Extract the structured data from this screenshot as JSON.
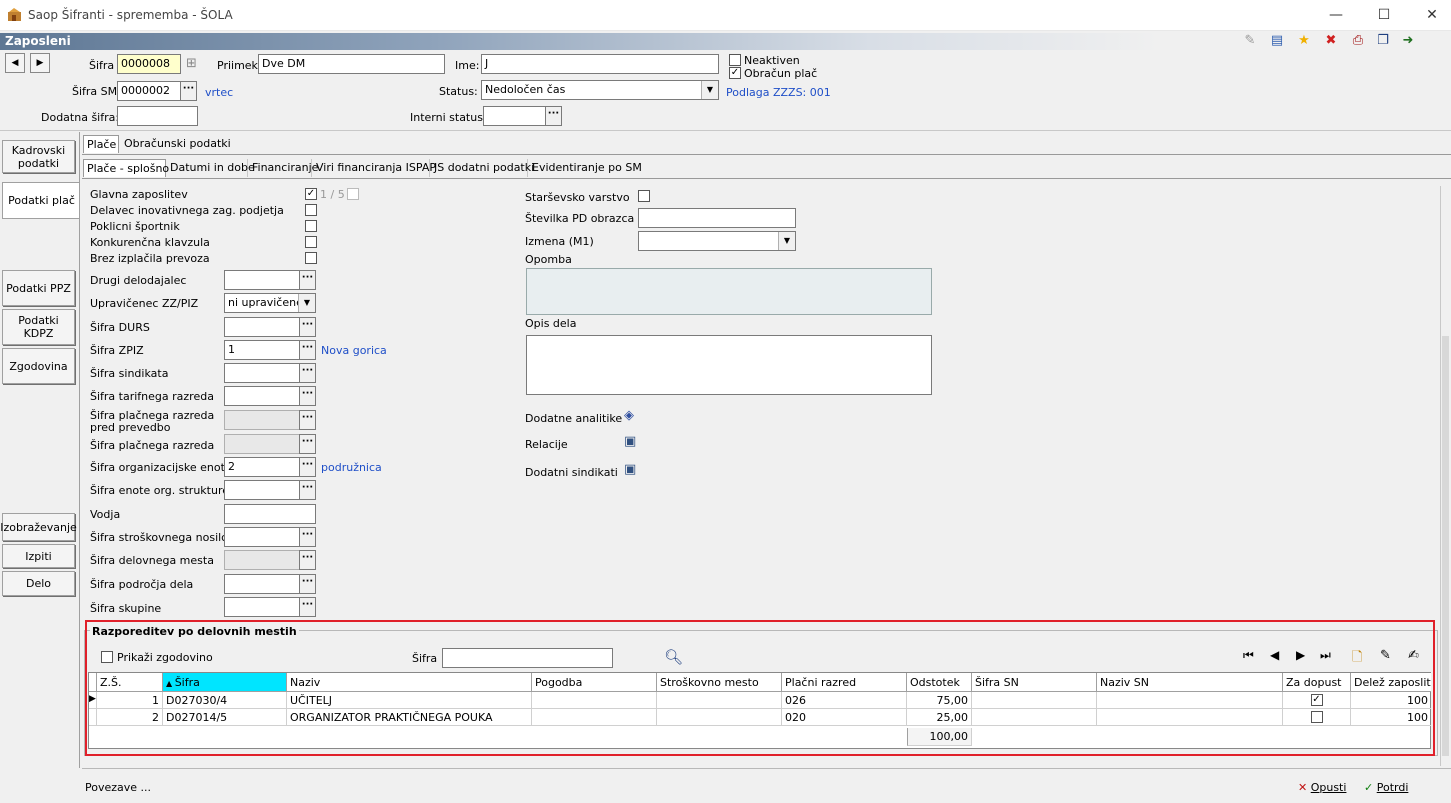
{
  "window": {
    "title": "Saop Šifranti - sprememba - ŠOLA",
    "header": "Zaposleni"
  },
  "top": {
    "sifra_label": "Šifra",
    "sifra_value": "0000008",
    "priimek_label": "Priimek:",
    "priimek_value": "Dve DM",
    "ime_label": "Ime:",
    "ime_value": "J",
    "neaktiven_label": "Neaktiven",
    "obracun_label": "Obračun plač",
    "sifra_sm_label": "Šifra SM",
    "sifra_sm_value": "0000002",
    "sm_name": "vrtec",
    "status_label": "Status:",
    "status_value": "Nedoločen čas",
    "podlaga": "Podlaga ZZZS: 001",
    "dodatna_label": "Dodatna šifra:",
    "dodatna_value": "",
    "interni_label": "Interni statusi:",
    "interni_value": ""
  },
  "sidebar": {
    "items": [
      {
        "label": "Kadrovski podatki"
      },
      {
        "label": "Podatki  plač"
      },
      {
        "label": "Podatki  PPZ"
      },
      {
        "label": "Podatki KDPZ"
      },
      {
        "label": "Zgodovina"
      },
      {
        "label": "Izobraževanje"
      },
      {
        "label": "Izpiti"
      },
      {
        "label": "Delo"
      }
    ]
  },
  "tabs_top": [
    "Plače",
    "Obračunski podatki"
  ],
  "tabs_sub": [
    "Plače - splošno",
    "Datumi in dobe",
    "Financiranje",
    "Viri financiranja ISPAP",
    "JS dodatni podatki",
    "Evidentiranje po SM"
  ],
  "left": {
    "glavna": "Glavna zaposlitev",
    "glavna_count": "1 / 5",
    "inovativ": "Delavec inovativnega zag. podjetja",
    "sportnik": "Poklicni športnik",
    "konkurencna": "Konkurenčna klavzula",
    "prevoz": "Brez izplačila prevoza",
    "drugi": "Drugi delodajalec",
    "upravicenec": "Upravičenec ZZ/PIZ",
    "upravicenec_value": "ni upravičenec",
    "durs": "Šifra DURS",
    "zpiz": "Šifra ZPIZ",
    "zpiz_value": "1",
    "zpiz_name": "Nova gorica",
    "sindikata": "Šifra sindikata",
    "tarifnega": "Šifra tarifnega razreda",
    "placnega_pred_1": "Šifra plačnega razreda",
    "placnega_pred_2": "pred prevedbo",
    "placnega": "Šifra plačnega razreda",
    "org_enote": "Šifra organizacijske enote",
    "org_enote_value": "2",
    "org_enote_name": "podružnica",
    "enote_strukture": "Šifra enote org. strukture",
    "vodja": "Vodja",
    "stroskovnega": "Šifra stroškovnega nosilca",
    "delovnega": "Šifra delovnega mesta",
    "podrocja": "Šifra področja dela",
    "skupine": "Šifra skupine"
  },
  "right": {
    "starsevsko": "Starševsko varstvo",
    "pd_obrazca": "Številka PD obrazca",
    "izmena": "Izmena (M1)",
    "opomba": "Opomba",
    "opis": "Opis dela",
    "analitike": "Dodatne analitike",
    "relacije": "Relacije",
    "sindikati": "Dodatni sindikati"
  },
  "razporeditev": {
    "title": "Razporeditev po delovnih mestih",
    "zgodovina": "Prikaži zgodovino",
    "sifra_label": "Šifra",
    "columns": [
      "Z.Š.",
      "Šifra",
      "Naziv",
      "Pogodba",
      "Stroškovno mesto",
      "Plačni razred",
      "Odstotek",
      "Šifra SN",
      "Naziv SN",
      "Za dopust",
      "Delež zaposlitve"
    ],
    "rows": [
      {
        "zs": "1",
        "sifra": "D027030/4",
        "naziv": "UČITELJ",
        "pogodba": "",
        "mesto": "",
        "razred": "026",
        "odstotek": "75,00",
        "sn": "",
        "naziv_sn": "",
        "dopust": true,
        "delez": "100"
      },
      {
        "zs": "2",
        "sifra": "D027014/5",
        "naziv": "ORGANIZATOR PRAKTIČNEGA POUKA",
        "pogodba": "",
        "mesto": "",
        "razred": "020",
        "odstotek": "25,00",
        "sn": "",
        "naziv_sn": "",
        "dopust": false,
        "delez": "100"
      }
    ],
    "total": "100,00"
  },
  "bottom": {
    "povezave": "Povezave ...",
    "opusti": "Opusti",
    "potrdi": "Potrdi"
  },
  "colors": {
    "accent": "#1f4fc8",
    "frame": "#e0202a",
    "header": "#5e7794"
  }
}
